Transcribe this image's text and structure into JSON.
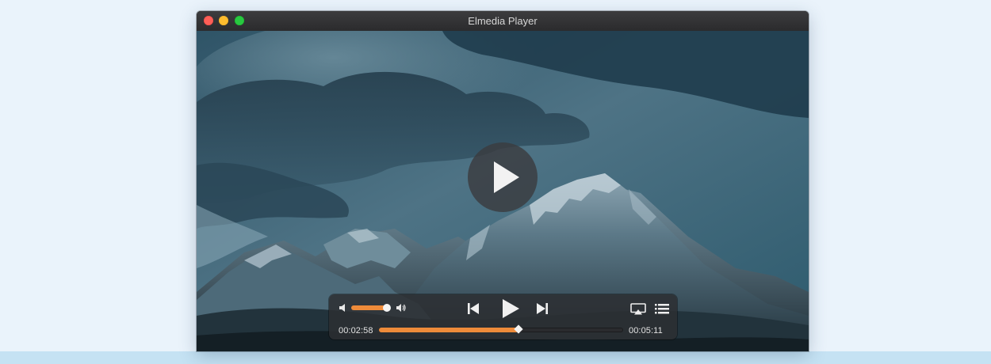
{
  "window": {
    "title": "Elmedia Player"
  },
  "player": {
    "current_time": "00:02:58",
    "total_time": "00:05:11",
    "progress": 0.57,
    "volume": 0.85,
    "accent_color": "#ee8b3a"
  },
  "icons": {
    "close": "close-traffic-light",
    "minimize": "minimize-traffic-light",
    "maximize": "maximize-traffic-light",
    "big_play": "play-icon",
    "volume_low": "volume-low-icon",
    "volume_high": "volume-high-icon",
    "previous": "skip-previous-icon",
    "play": "play-icon",
    "next": "skip-next-icon",
    "airplay": "airplay-icon",
    "playlist": "playlist-icon"
  }
}
